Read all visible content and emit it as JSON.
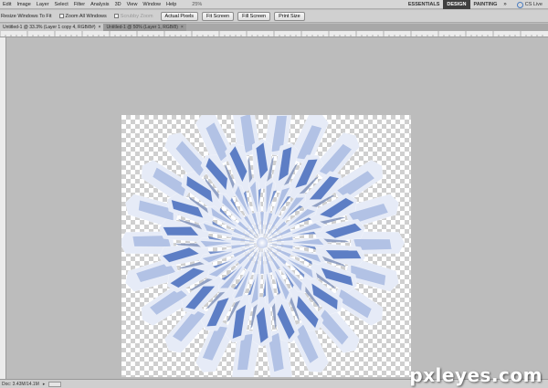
{
  "menubar": {
    "items": [
      "Edit",
      "Image",
      "Layer",
      "Select",
      "Filter",
      "Analysis",
      "3D",
      "View",
      "Window",
      "Help"
    ],
    "zoom_display": "25%",
    "workspaces": [
      "ESSENTIALS",
      "DESIGN",
      "PAINTING"
    ],
    "active_workspace": "DESIGN",
    "more_symbol": "»",
    "cs_live": "CS Live"
  },
  "optionsbar": {
    "resize_windows": "Resize Windows To Fit",
    "zoom_all_windows": "Zoom All Windows",
    "scrubby_zoom": "Scrubby Zoom",
    "actual_pixels": "Actual Pixels",
    "fit_screen": "Fit Screen",
    "fill_screen": "Fill Screen",
    "print_size": "Print Size"
  },
  "tabs": [
    {
      "label": "Untitled-1 @ 33.3% (Layer 1 copy 4, RGB/8#)",
      "close": "×",
      "active": true
    },
    {
      "label": "Untitled-1 @ 50% (Layer 1, RGB/8)",
      "close": "×",
      "active": false
    }
  ],
  "statusbar": {
    "info": "Doc: 3.43M/14.1M",
    "arrow": "▸"
  },
  "colors": {
    "petal_light": "#e6ebf7",
    "petal_mid": "#a9bbe3",
    "petal_dark": "#4f73c0",
    "petal_shade": "#7c8fb9"
  },
  "watermark": "pxleyes.com"
}
